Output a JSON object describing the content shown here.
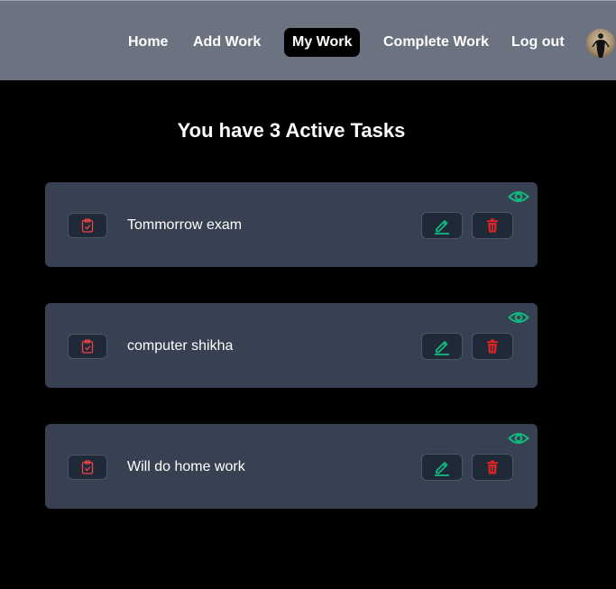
{
  "nav": {
    "items": [
      {
        "label": "Home"
      },
      {
        "label": "Add Work"
      },
      {
        "label": "My Work",
        "active": true
      },
      {
        "label": "Complete Work"
      },
      {
        "label": "Log out"
      }
    ],
    "avatar_icon": "user-avatar"
  },
  "main": {
    "title": "You have 3 Active Tasks",
    "tasks": [
      {
        "text": "Tommorrow exam"
      },
      {
        "text": "computer shikha"
      },
      {
        "text": "Will do home work"
      }
    ]
  },
  "icons": {
    "view": "eye-icon",
    "task": "clipboard-check-icon",
    "edit": "pencil-icon",
    "delete": "trash-icon"
  },
  "colors": {
    "navbar": "#6b7280",
    "background": "#000000",
    "card": "#374151",
    "button": "#1f2937",
    "green_accent": "#10b981",
    "red_accent": "#dc2626"
  }
}
